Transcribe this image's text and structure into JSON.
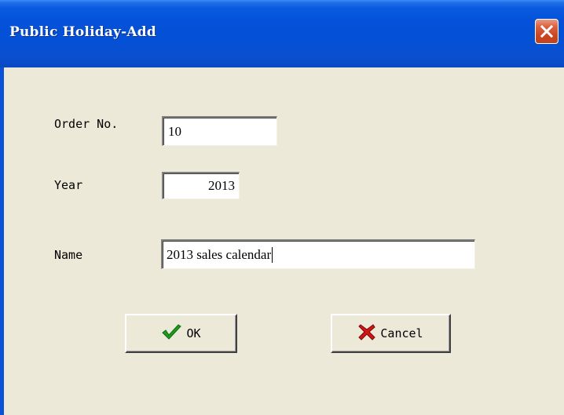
{
  "window": {
    "title": "Public Holiday-Add",
    "close_icon": "close-x-icon"
  },
  "form": {
    "order_no": {
      "label": "Order No.",
      "value": "10"
    },
    "year": {
      "label": "Year",
      "value": "2013"
    },
    "name": {
      "label": "Name",
      "value": "2013 sales calendar"
    }
  },
  "buttons": {
    "ok": {
      "label": "OK",
      "icon": "checkmark-icon",
      "icon_color": "#1f9a1f"
    },
    "cancel": {
      "label": "Cancel",
      "icon": "red-x-icon",
      "icon_color": "#d01515"
    }
  },
  "colors": {
    "titlebar": "#0552d9",
    "dialog_background": "#ece9d8",
    "close_button": "#c94520"
  }
}
